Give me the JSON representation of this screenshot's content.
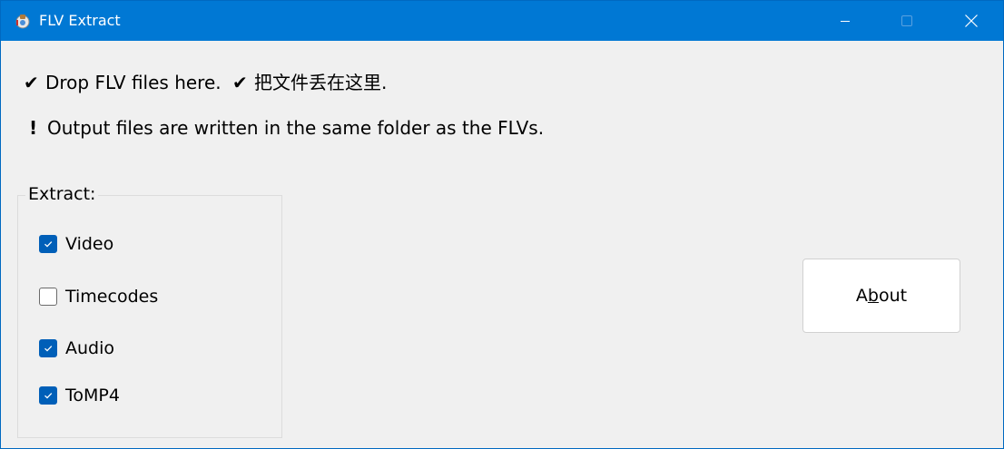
{
  "window": {
    "title": "FLV Extract"
  },
  "caption_buttons": {
    "minimize_icon": "minimize-icon",
    "maximize_icon": "maximize-icon",
    "close_icon": "close-icon"
  },
  "info": {
    "drop_check": "✔",
    "drop_en": "Drop FLV files here.",
    "drop_zh_check": "✔",
    "drop_zh": "把文件丢在这里.",
    "output_mark": "!",
    "output_text": "Output files are written in the same folder as the FLVs."
  },
  "extract_group": {
    "legend": "Extract:",
    "options": [
      {
        "label": "Video",
        "checked": true
      },
      {
        "label": "Timecodes",
        "checked": false
      },
      {
        "label": "Audio",
        "checked": true
      },
      {
        "label": "ToMP4",
        "checked": true
      }
    ]
  },
  "about_button": {
    "prefix": "A",
    "mnemonic": "b",
    "suffix": "out"
  },
  "colors": {
    "titlebar": "#0078d4",
    "client_bg": "#f0f0f0",
    "checkbox_accent": "#005fb8"
  }
}
